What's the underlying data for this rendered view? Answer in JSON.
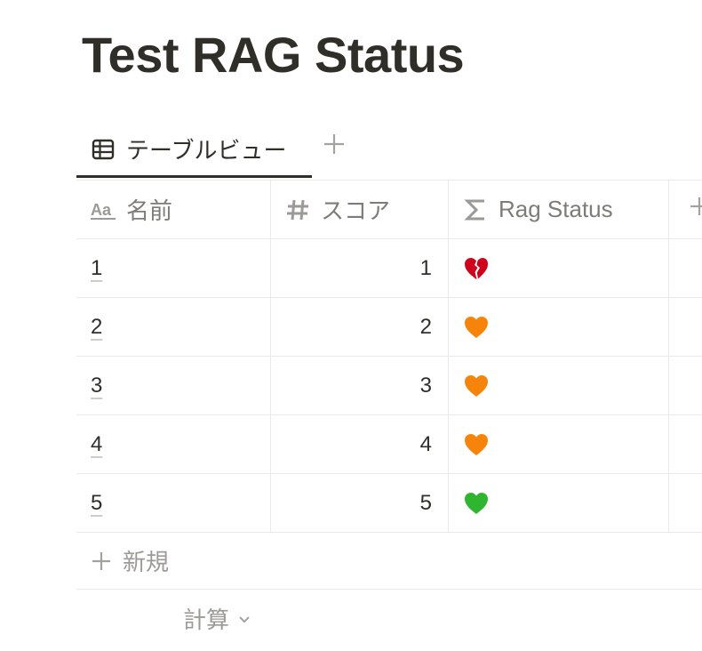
{
  "page": {
    "title": "Test RAG Status"
  },
  "tabs": [
    {
      "label": "テーブルビュー",
      "icon": "table-icon",
      "active": true
    }
  ],
  "add_view": {
    "icon": "plus-icon"
  },
  "columns": [
    {
      "label": "名前",
      "icon": "text-property-icon"
    },
    {
      "label": "スコア",
      "icon": "number-property-icon"
    },
    {
      "label": "Rag Status",
      "icon": "formula-sigma-icon"
    },
    {
      "label": "",
      "icon": "plus-icon"
    }
  ],
  "rows": [
    {
      "name": "1",
      "score": "1",
      "rag_icon": "broken-heart-icon",
      "rag_color": "#d0021b"
    },
    {
      "name": "2",
      "score": "2",
      "rag_icon": "orange-heart-icon",
      "rag_color": "#f7840a"
    },
    {
      "name": "3",
      "score": "3",
      "rag_icon": "orange-heart-icon",
      "rag_color": "#f7840a"
    },
    {
      "name": "4",
      "score": "4",
      "rag_icon": "orange-heart-icon",
      "rag_color": "#f7840a"
    },
    {
      "name": "5",
      "score": "5",
      "rag_icon": "green-heart-icon",
      "rag_color": "#2fb52f"
    }
  ],
  "new_row": {
    "label": "新規",
    "icon": "plus-icon"
  },
  "calculate": {
    "label": "計算",
    "icon": "chevron-down-icon"
  },
  "colors": {
    "text": "#2f2e29",
    "muted": "#7d7c78",
    "border": "#e9e9e7"
  }
}
